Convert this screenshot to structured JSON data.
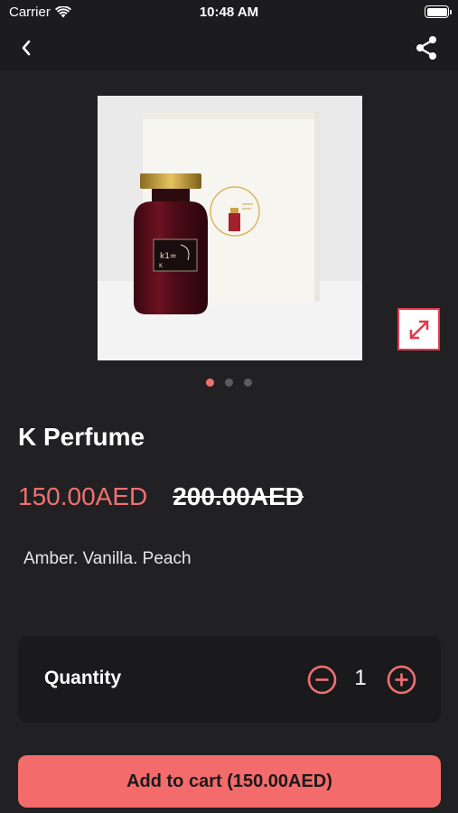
{
  "status_bar": {
    "carrier": "Carrier",
    "time": "10:48 AM"
  },
  "nav": {
    "back_icon": "chevron-left-icon",
    "share_icon": "share-icon"
  },
  "product": {
    "name": "K Perfume",
    "price_current": "150.00AED",
    "price_original": "200.00AED",
    "description": "Amber. Vanilla. Peach",
    "image_count": 3,
    "active_image": 1
  },
  "quantity": {
    "label": "Quantity",
    "value": "1"
  },
  "cart": {
    "button_label": "Add to cart (150.00AED)"
  },
  "colors": {
    "background": "#1c1c1e",
    "content_background": "#212124",
    "accent": "#f27070",
    "button": "#f46b6b",
    "expand_border": "#e23a4f"
  }
}
